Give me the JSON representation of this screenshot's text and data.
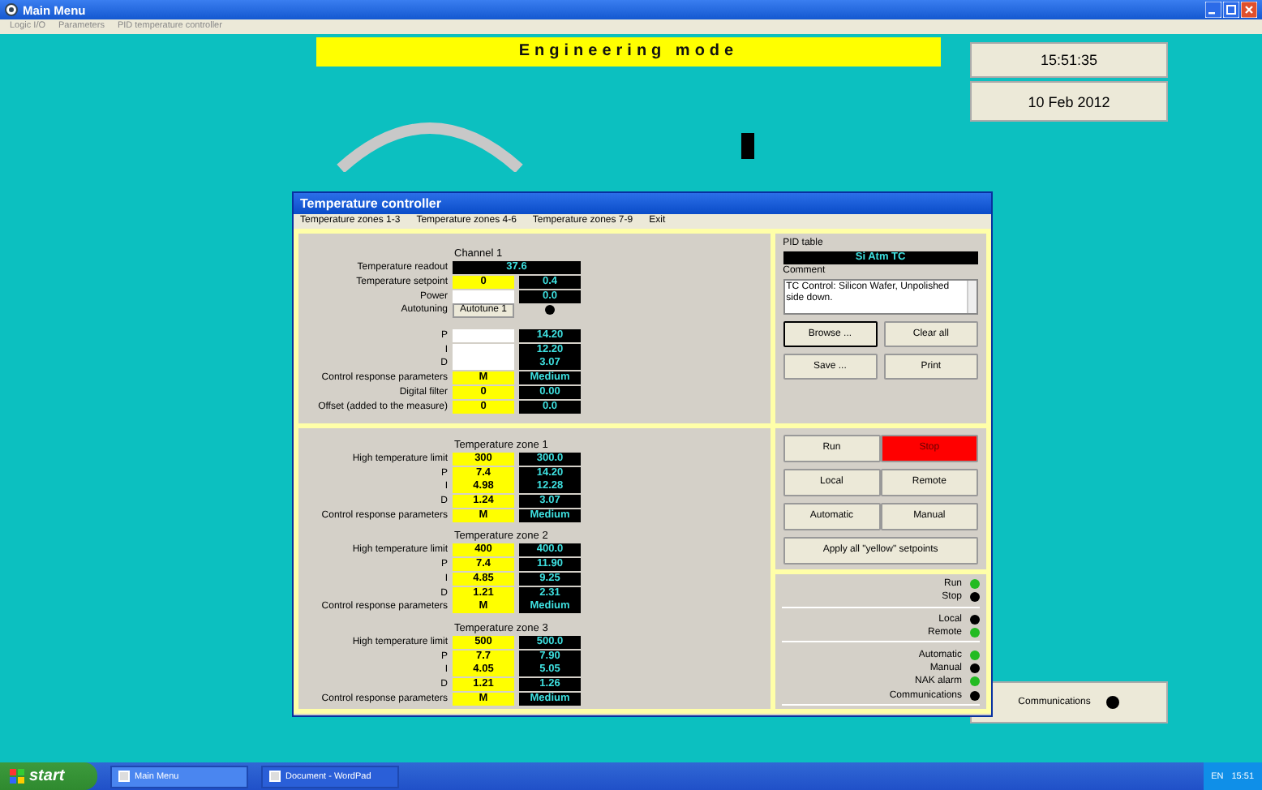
{
  "window": {
    "title": "Main Menu"
  },
  "breadcrumb": [
    "Logic I/O",
    "Parameters",
    "PID temperature controller"
  ],
  "banner": "Engineering mode",
  "clock": {
    "time": "15:51:35",
    "date": "10 Feb 2012"
  },
  "dialog": {
    "title": "Temperature controller",
    "menu": [
      "Temperature zones 1-3",
      "Temperature zones 4-6",
      "Temperature zones 7-9",
      "Exit"
    ],
    "channel": {
      "title": "Channel 1",
      "groups": [
        [
          {
            "kind": "readout",
            "label": "Temperature readout",
            "value": "37.6"
          },
          {
            "kind": "pair",
            "label": "Temperature setpoint",
            "yellow": true,
            "setpoint": "0",
            "value": "0.4"
          },
          {
            "kind": "pair",
            "label": "Power",
            "yellow": false,
            "value": "0.0"
          },
          {
            "kind": "autotune",
            "label": "Autotuning",
            "button": "Autotune 1",
            "on": false
          }
        ],
        [
          {
            "kind": "pair",
            "label": "P",
            "yellow": false,
            "value": "14.20"
          },
          {
            "kind": "pair",
            "label": "I",
            "yellow": false,
            "value": "12.20"
          },
          {
            "kind": "pair",
            "label": "D",
            "yellow": false,
            "value": "3.07"
          },
          {
            "kind": "pair",
            "label": "Control response parameters",
            "yellow": true,
            "setpoint": "M",
            "value": "Medium"
          },
          {
            "kind": "pair",
            "label": "Digital filter",
            "yellow": true,
            "setpoint": "0",
            "value": "0.00"
          },
          {
            "kind": "pair",
            "label": "Offset (added to the measure)",
            "yellow": true,
            "setpoint": "0",
            "value": "0.0"
          }
        ]
      ]
    },
    "zones": [
      {
        "title": "Temperature zone 1",
        "rows": [
          {
            "kind": "pair",
            "label": "High temperature limit",
            "yellow": true,
            "setpoint": "300",
            "value": "300.0"
          },
          {
            "kind": "pair",
            "label": "P",
            "yellow": true,
            "setpoint": "7.4",
            "value": "14.20"
          },
          {
            "kind": "pair",
            "label": "I",
            "yellow": true,
            "setpoint": "4.98",
            "value": "12.28"
          },
          {
            "kind": "pair",
            "label": "D",
            "yellow": true,
            "setpoint": "1.24",
            "value": "3.07"
          },
          {
            "kind": "pair",
            "label": "Control response parameters",
            "yellow": true,
            "setpoint": "M",
            "value": "Medium"
          }
        ]
      },
      {
        "title": "Temperature zone 2",
        "rows": [
          {
            "kind": "pair",
            "label": "High temperature limit",
            "yellow": true,
            "setpoint": "400",
            "value": "400.0"
          },
          {
            "kind": "pair",
            "label": "P",
            "yellow": true,
            "setpoint": "7.4",
            "value": "11.90"
          },
          {
            "kind": "pair",
            "label": "I",
            "yellow": true,
            "setpoint": "4.85",
            "value": "9.25"
          },
          {
            "kind": "pair",
            "label": "D",
            "yellow": true,
            "setpoint": "1.21",
            "value": "2.31"
          },
          {
            "kind": "pair",
            "label": "Control response parameters",
            "yellow": true,
            "setpoint": "M",
            "value": "Medium"
          }
        ]
      },
      {
        "title": "Temperature zone 3",
        "rows": [
          {
            "kind": "pair",
            "label": "High temperature limit",
            "yellow": true,
            "setpoint": "500",
            "value": "500.0"
          },
          {
            "kind": "pair",
            "label": "P",
            "yellow": true,
            "setpoint": "7.7",
            "value": "7.90"
          },
          {
            "kind": "pair",
            "label": "I",
            "yellow": true,
            "setpoint": "4.05",
            "value": "5.05"
          },
          {
            "kind": "pair",
            "label": "D",
            "yellow": true,
            "setpoint": "1.21",
            "value": "1.26"
          },
          {
            "kind": "pair",
            "label": "Control response parameters",
            "yellow": true,
            "setpoint": "M",
            "value": "Medium"
          }
        ]
      }
    ],
    "pid_table": {
      "label": "PID table",
      "value": "Si Atm TC",
      "comment_label": "Comment",
      "comment": "TC Control: Silicon Wafer, Unpolished side down.",
      "buttons": [
        "Browse ...",
        "Clear all",
        "Save ...",
        "Print"
      ]
    },
    "controls": [
      [
        {
          "label": "Run",
          "active": false
        },
        {
          "label": "Stop",
          "active": true
        }
      ],
      [
        {
          "label": "Local",
          "active": false
        },
        {
          "label": "Remote",
          "active": false
        }
      ],
      [
        {
          "label": "Automatic",
          "active": false
        },
        {
          "label": "Manual",
          "active": false
        }
      ],
      [
        {
          "label": "Apply all \"yellow\" setpoints",
          "active": false
        }
      ]
    ],
    "status": [
      [
        {
          "label": "Run",
          "on": true
        },
        {
          "label": "Stop",
          "on": false
        }
      ],
      [
        {
          "label": "Local",
          "on": false
        },
        {
          "label": "Remote",
          "on": true
        }
      ],
      [
        {
          "label": "Automatic",
          "on": true
        },
        {
          "label": "Manual",
          "on": false
        },
        {
          "label": "NAK alarm",
          "on": true
        },
        {
          "label": "Communications",
          "on": false
        }
      ]
    ]
  },
  "communications": {
    "label": "Communications",
    "on": false
  },
  "taskbar": {
    "start": "start",
    "tasks": [
      {
        "label": "Main Menu",
        "selected": true
      },
      {
        "label": "Document - WordPad",
        "selected": false
      }
    ],
    "tray": [
      "EN",
      "15:51"
    ]
  }
}
